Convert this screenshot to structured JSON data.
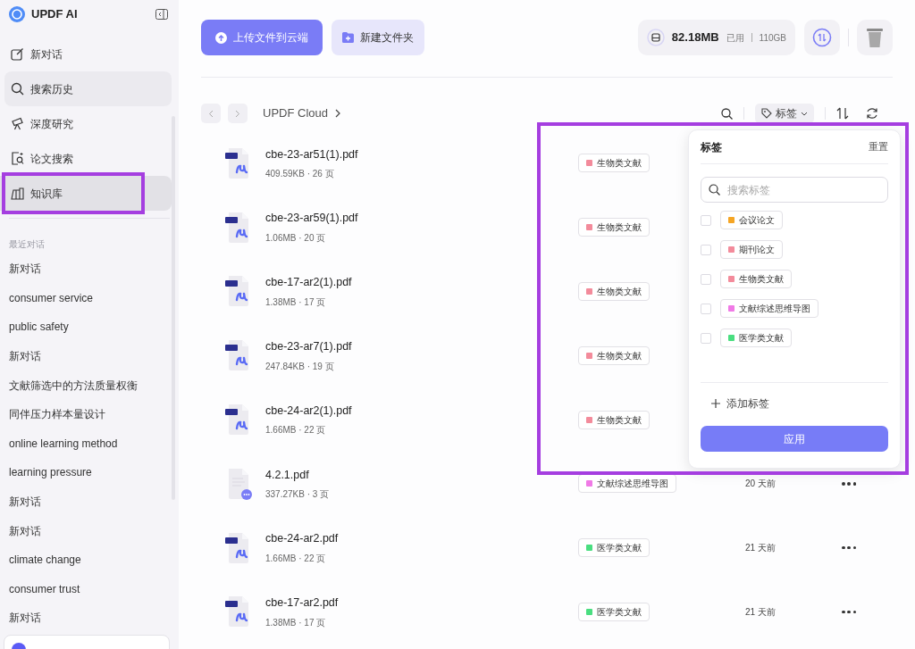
{
  "app": {
    "title": "UPDF AI"
  },
  "nav": [
    {
      "label": "新对话",
      "selected": false,
      "hovered": false,
      "annotated": false
    },
    {
      "label": "搜索历史",
      "selected": false,
      "hovered": true,
      "annotated": false
    },
    {
      "label": "深度研究",
      "selected": false,
      "hovered": false,
      "annotated": false
    },
    {
      "label": "论文搜索",
      "selected": false,
      "hovered": false,
      "annotated": false
    },
    {
      "label": "知识库",
      "selected": true,
      "hovered": false,
      "annotated": true
    }
  ],
  "recent": {
    "heading": "最近对话",
    "items": [
      "新对话",
      "consumer service",
      "public safety",
      "新对话",
      "文献筛选中的方法质量权衡",
      "同伴压力样本量设计",
      "online learning method",
      "learning pressure",
      "新对话",
      "新对话",
      "climate change",
      "consumer trust",
      "新对话"
    ]
  },
  "toolbar": {
    "upload": "上传文件到云端",
    "new_folder": "新建文件夹",
    "storage_used": "82.18MB",
    "storage_label": "已用",
    "storage_total": "110GB"
  },
  "breadcrumb": "UPDF Cloud",
  "filter_button": "标签",
  "files": [
    {
      "name": "cbe-23-ar51(1).pdf",
      "meta": "409.59KB · 26 页",
      "kind": "pdf",
      "tag": "生物类文献",
      "color": "#f38b9b"
    },
    {
      "name": "cbe-23-ar59(1).pdf",
      "meta": "1.06MB · 20 页",
      "kind": "pdf",
      "tag": "生物类文献",
      "color": "#f38b9b"
    },
    {
      "name": "cbe-17-ar2(1).pdf",
      "meta": "1.38MB · 17 页",
      "kind": "pdf",
      "tag": "生物类文献",
      "color": "#f38b9b"
    },
    {
      "name": "cbe-23-ar7(1).pdf",
      "meta": "247.84KB · 19 页",
      "kind": "pdf",
      "tag": "生物类文献",
      "color": "#f38b9b"
    },
    {
      "name": "cbe-24-ar2(1).pdf",
      "meta": "1.66MB · 22 页",
      "kind": "pdf",
      "tag": "生物类文献",
      "color": "#f38b9b"
    },
    {
      "name": "4.2.1.pdf",
      "meta": "337.27KB · 3 页",
      "kind": "chat-doc",
      "tag": "文献综述思维导图",
      "color": "#f07ae6",
      "time": "20 天前"
    },
    {
      "name": "cbe-24-ar2.pdf",
      "meta": "1.66MB · 22 页",
      "kind": "pdf",
      "tag": "医学类文献",
      "color": "#4ade80",
      "time": "21 天前"
    },
    {
      "name": "cbe-17-ar2.pdf",
      "meta": "1.38MB · 17 页",
      "kind": "pdf",
      "tag": "医学类文献",
      "color": "#4ade80",
      "time": "21 天前"
    }
  ],
  "tag_panel": {
    "title": "标签",
    "reset": "重置",
    "search_placeholder": "搜索标签",
    "annotated": true,
    "tags": [
      {
        "label": "会议论文",
        "color": "#f5a524",
        "checked": false
      },
      {
        "label": "期刊论文",
        "color": "#f38b9b",
        "checked": false
      },
      {
        "label": "生物类文献",
        "color": "#f38b9b",
        "checked": false
      },
      {
        "label": "文献综述思维导图",
        "color": "#f07ae6",
        "checked": false
      },
      {
        "label": "医学类文献",
        "color": "#4ade80",
        "checked": false
      }
    ],
    "add": "添加标签",
    "apply": "应用"
  }
}
